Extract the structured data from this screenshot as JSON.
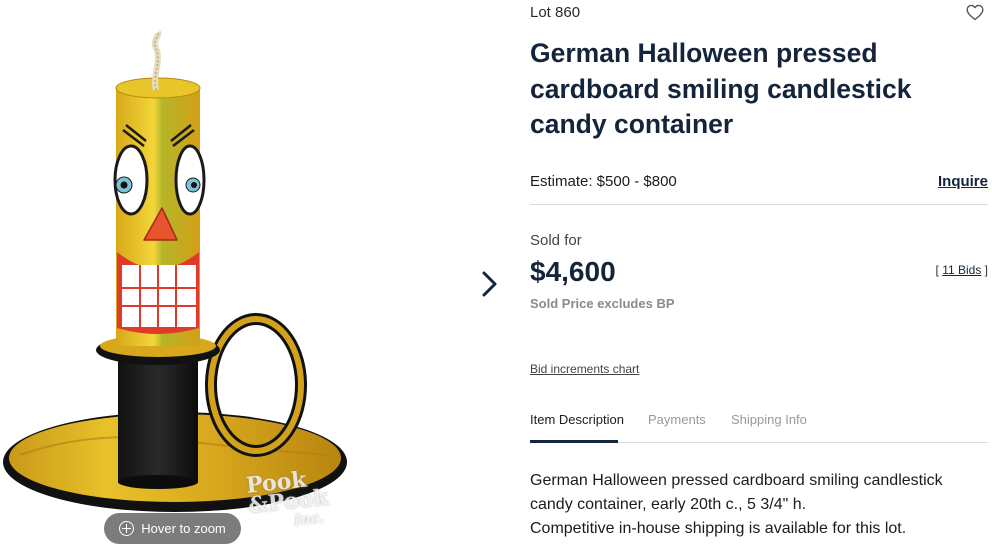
{
  "image": {
    "watermark_line1": "Pook",
    "watermark_line2": "&Pook",
    "watermark_line3": "Inc.",
    "zoom_hint": "Hover to zoom"
  },
  "lot": {
    "number_label": "Lot 860",
    "title": "German Halloween pressed cardboard smiling candlestick candy container",
    "estimate": "Estimate: $500 - $800",
    "inquire_label": "Inquire",
    "sold_label": "Sold for",
    "sold_price": "$4,600",
    "bids_open": "[ ",
    "bids_label": "11 Bids",
    "bids_close": " ]",
    "sold_note": "Sold Price excludes BP",
    "increments_link": "Bid increments chart"
  },
  "tabs": [
    {
      "label": "Item Description",
      "active": true
    },
    {
      "label": "Payments",
      "active": false
    },
    {
      "label": "Shipping Info",
      "active": false
    }
  ],
  "description": {
    "line1": "German Halloween pressed cardboard smiling candlestick candy container, early 20th c., 5 3/4\" h.",
    "line2": "Competitive in-house shipping is available for this lot."
  },
  "colors": {
    "title_navy": "#14243b",
    "muted_gray": "#8a8a8a",
    "divider": "#dcdcdc"
  },
  "icons": {
    "favorite": "heart-outline-icon",
    "next": "chevron-right-icon",
    "zoom": "plus-circle-icon"
  }
}
